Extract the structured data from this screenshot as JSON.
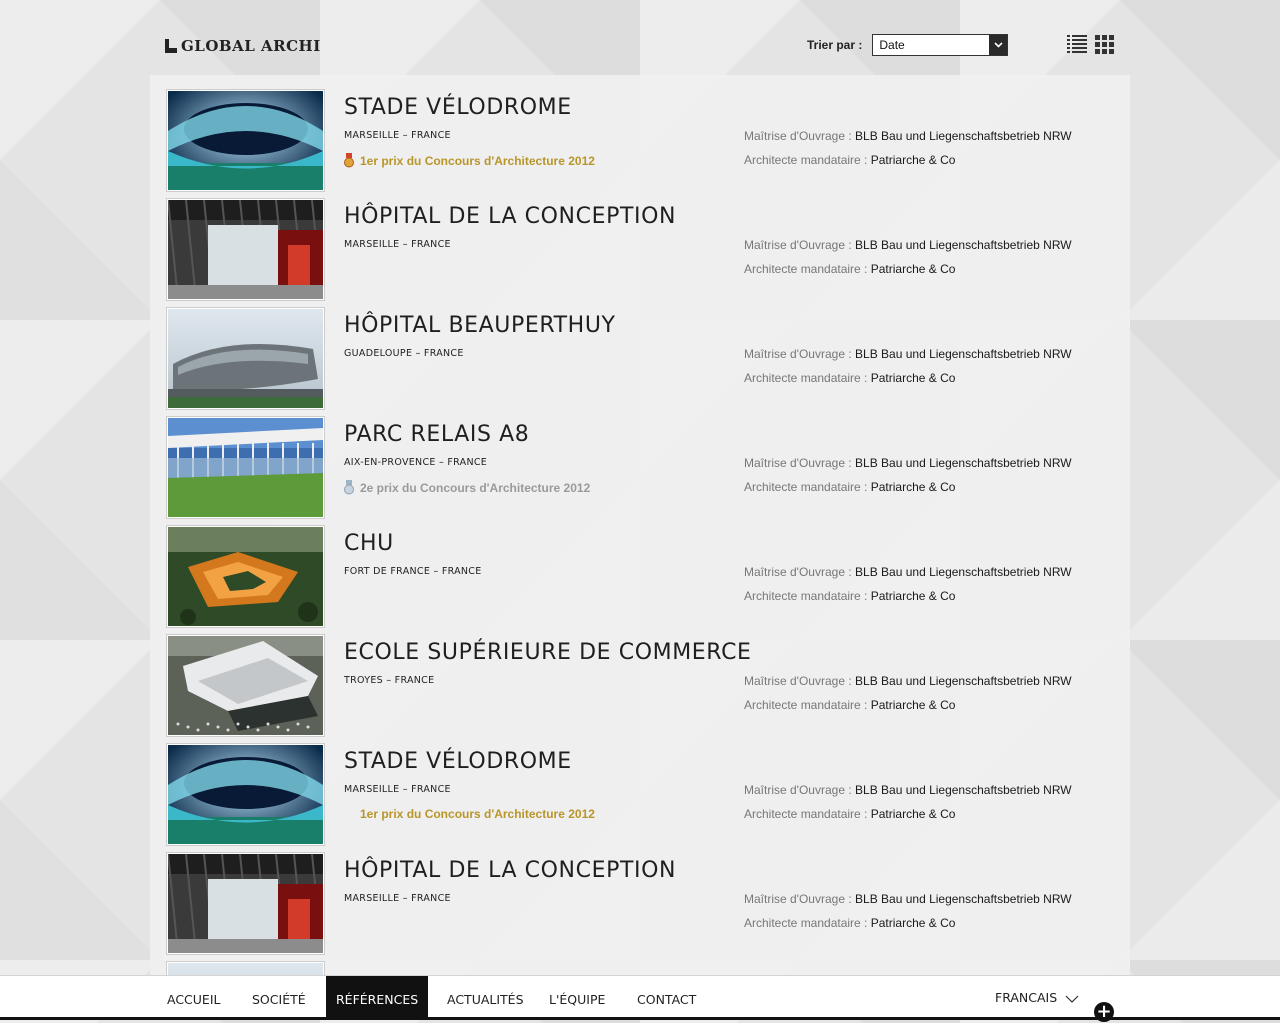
{
  "header": {
    "logo_text": "GLOBAL ARCHI",
    "sort_label": "Trier par :",
    "sort_value": "Date",
    "view_icons": [
      "list-view-icon",
      "grid-view-icon"
    ]
  },
  "labels": {
    "maitrise": "Maîtrise d'Ouvrage :",
    "architecte": "Architecte mandataire :"
  },
  "projects": [
    {
      "title": "STADE VÉLODROME",
      "location": "MARSEILLE – FRANCE",
      "award": "1er prix du Concours d'Architecture 2012",
      "award_type": "gold",
      "maitrise": "BLB Bau und Liegenschaftsbetrieb NRW",
      "architecte": "Patriarche & Co",
      "thumb": "stadium"
    },
    {
      "title": "HÔPITAL DE LA CONCEPTION",
      "location": "MARSEILLE – FRANCE",
      "award": "",
      "award_type": "",
      "maitrise": "BLB Bau und Liegenschaftsbetrieb NRW",
      "architecte": "Patriarche & Co",
      "thumb": "hospital"
    },
    {
      "title": "HÔPITAL BEAUPERTHUY",
      "location": "GUADELOUPE – FRANCE",
      "award": "",
      "award_type": "",
      "maitrise": "BLB Bau und Liegenschaftsbetrieb NRW",
      "architecte": "Patriarche & Co",
      "thumb": "ring"
    },
    {
      "title": "PARC RELAIS A8",
      "location": "AIX-EN-PROVENCE – FRANCE",
      "award": "2e prix du Concours d'Architecture 2012",
      "award_type": "silver",
      "maitrise": "BLB Bau und Liegenschaftsbetrieb NRW",
      "architecte": "Patriarche & Co",
      "thumb": "canopy"
    },
    {
      "title": "CHU",
      "location": "FORT DE FRANCE – FRANCE",
      "award": "",
      "award_type": "",
      "maitrise": "BLB Bau und Liegenschaftsbetrieb NRW",
      "architecte": "Patriarche & Co",
      "thumb": "aerial"
    },
    {
      "title": "ECOLE SUPÉRIEURE DE COMMERCE",
      "location": "TROYES – FRANCE",
      "award": "",
      "award_type": "",
      "maitrise": "BLB Bau und Liegenschaftsbetrieb NRW",
      "architecte": "Patriarche & Co",
      "thumb": "school"
    },
    {
      "title": "STADE VÉLODROME",
      "location": "MARSEILLE – FRANCE",
      "award": "1er prix du Concours d'Architecture 2012",
      "award_type": "gold-nomedal",
      "maitrise": "BLB Bau und Liegenschaftsbetrieb NRW",
      "architecte": "Patriarche & Co",
      "thumb": "stadium"
    },
    {
      "title": "HÔPITAL DE LA CONCEPTION",
      "location": "MARSEILLE – FRANCE",
      "award": "",
      "award_type": "",
      "maitrise": "BLB Bau und Liegenschaftsbetrieb NRW",
      "architecte": "Patriarche & Co",
      "thumb": "hospital"
    }
  ],
  "nav": {
    "items": [
      "ACCUEIL",
      "SOCIÉTÉ",
      "RÉFÉRENCES",
      "ACTUALITÉS",
      "L'ÉQUIPE",
      "CONTACT"
    ],
    "active": "RÉFÉRENCES",
    "language": "FRANCAIS",
    "plus": "+"
  }
}
